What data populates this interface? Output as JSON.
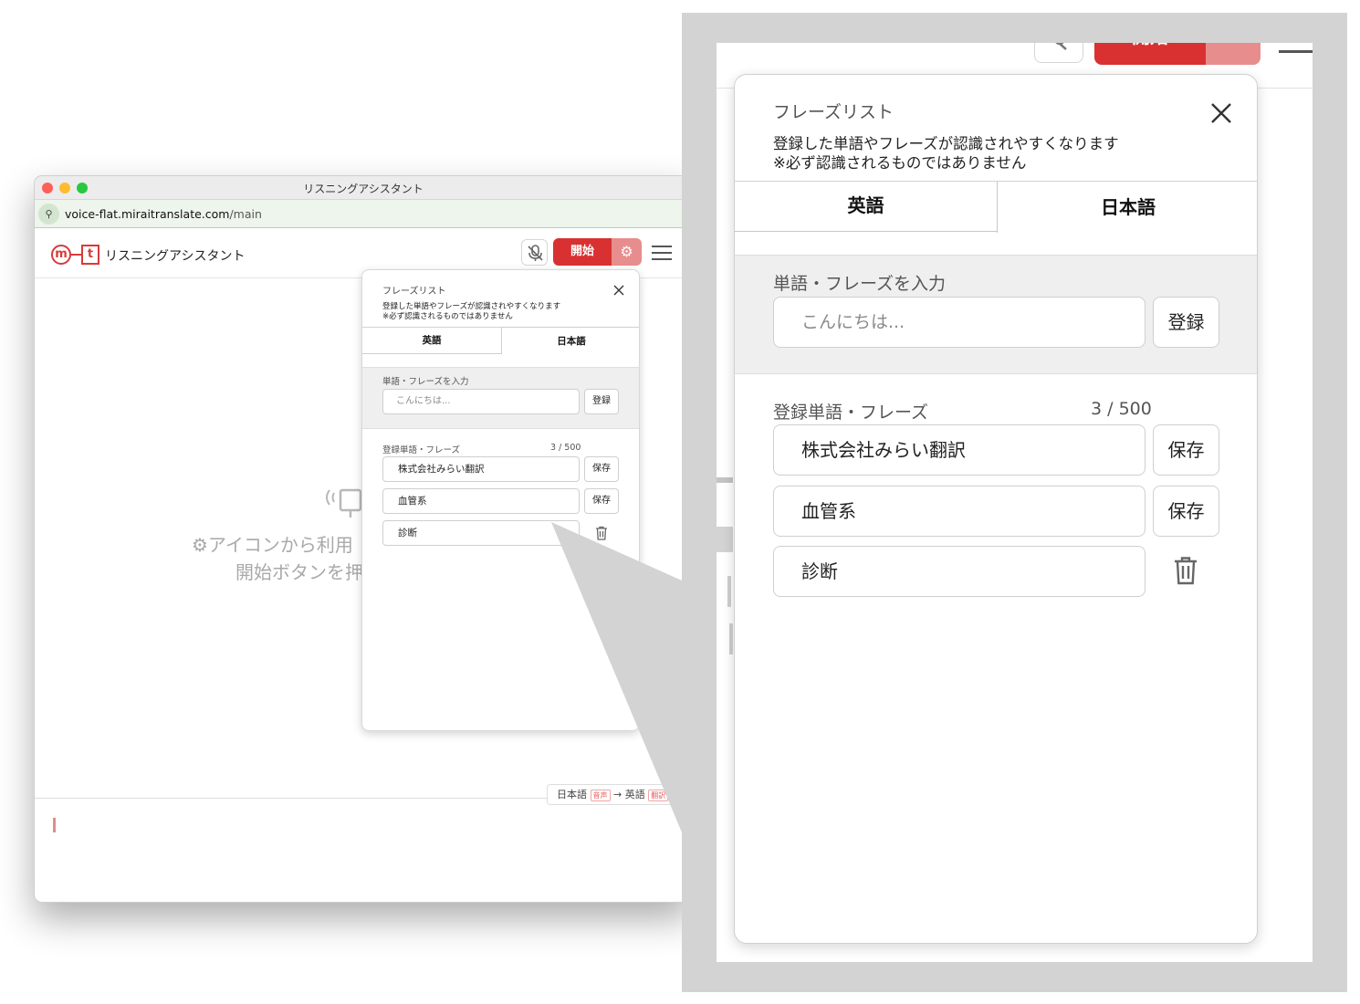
{
  "window": {
    "title": "リスニングアシスタント",
    "url_domain": "voice-flat.miraitranslate.com",
    "url_path": "/main",
    "traffic_colors": [
      "#fe5f57",
      "#febc2e",
      "#28c840"
    ]
  },
  "header": {
    "logo_m": "m",
    "logo_t": "t",
    "app_title": "リスニングアシスタント",
    "start_label": "開始",
    "gear_glyph": "⚙",
    "accent": "#d93131"
  },
  "empty": {
    "line1": "⚙アイコンから利用",
    "line2": "開始ボタンを押"
  },
  "lang_pill": {
    "source": "日本語",
    "source_tag": "音声",
    "arrow": "→",
    "target": "英語",
    "target_tag": "翻訳"
  },
  "phrase_panel": {
    "title": "フレーズリスト",
    "desc1": "登録した単語やフレーズが認識されやすくなります",
    "desc2": "※必ず認識されるものではありません",
    "tabs": [
      {
        "label": "英語",
        "active": false
      },
      {
        "label": "日本語",
        "active": true
      }
    ],
    "input_label": "単語・フレーズを入力",
    "input_placeholder": "こんにちは...",
    "register_label": "登録",
    "list_label": "登録単語・フレーズ",
    "count": "3 / 500",
    "save_label": "保存",
    "items": [
      {
        "text": "株式会社みらい翻訳",
        "action": "save"
      },
      {
        "text": "血管系",
        "action": "save"
      },
      {
        "text": "診断",
        "action": "delete"
      }
    ]
  },
  "zoom_background": {
    "start_label": "開始"
  }
}
